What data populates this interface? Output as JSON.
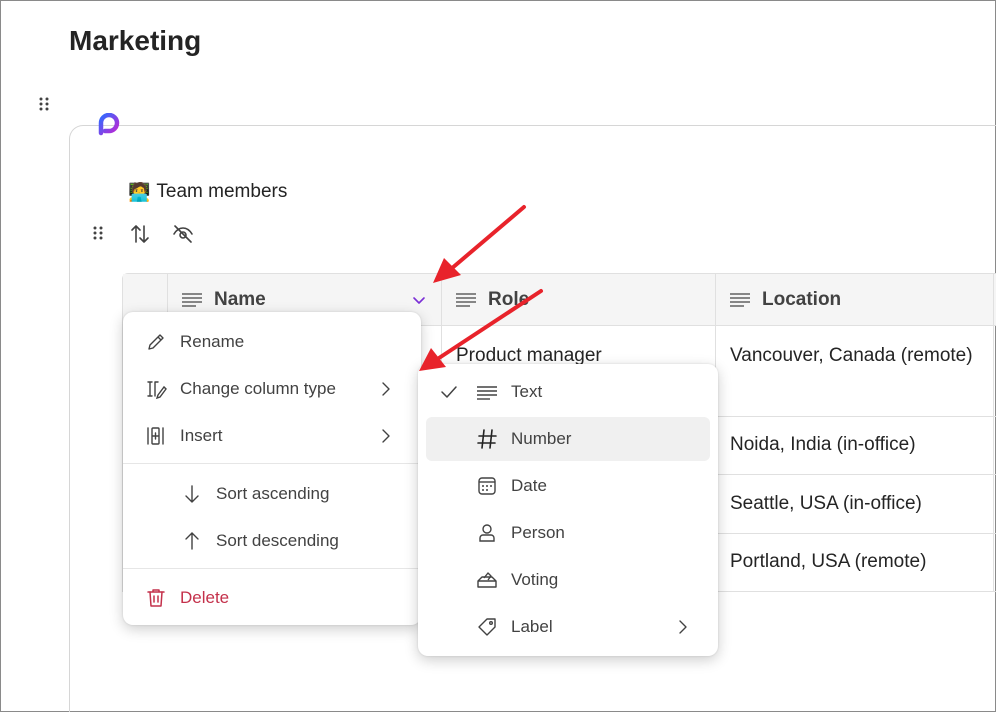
{
  "page": {
    "title": "Marketing"
  },
  "table": {
    "emoji": "🧑‍💻",
    "title": "Team members",
    "columns": [
      "Name",
      "Role",
      "Location"
    ],
    "rows": [
      {
        "name": "",
        "role": "Product manager",
        "location": "Vancouver, Canada (remote)"
      },
      {
        "name": "",
        "role": "",
        "location": "Noida, India (in-office)"
      },
      {
        "name": "",
        "role": "",
        "location": "Seattle, USA (in-office)"
      },
      {
        "name": "",
        "role": "",
        "location": "Portland, USA (remote)"
      }
    ]
  },
  "column_menu": {
    "rename": "Rename",
    "change_type": "Change column type",
    "insert": "Insert",
    "sort_asc": "Sort ascending",
    "sort_desc": "Sort descending",
    "delete": "Delete"
  },
  "type_menu": {
    "selected": "Text",
    "hovered": "Number",
    "items": [
      "Text",
      "Number",
      "Date",
      "Person",
      "Voting",
      "Label"
    ]
  },
  "colors": {
    "accent": "#7b2fd6",
    "danger": "#c4314b",
    "annotation_arrow": "#e8232b"
  }
}
